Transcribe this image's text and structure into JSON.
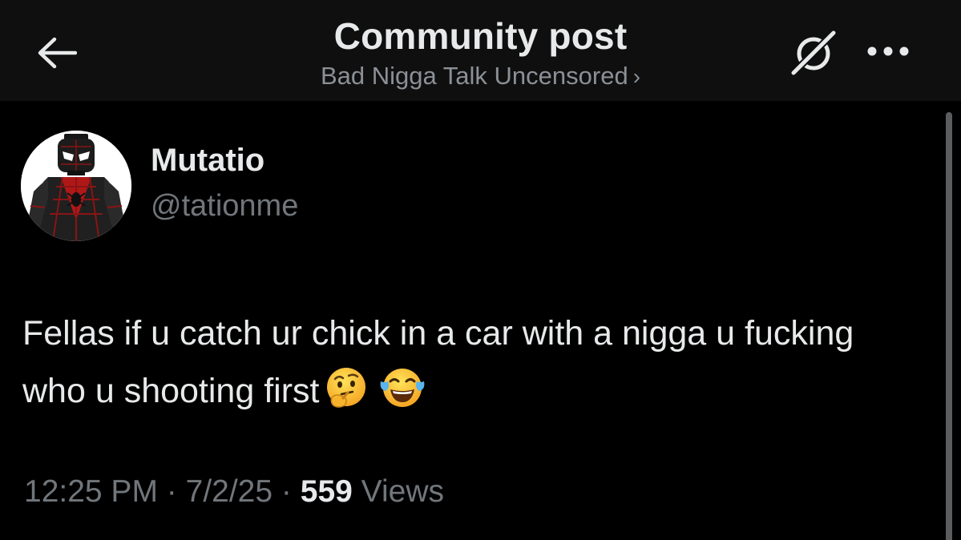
{
  "header": {
    "title": "Community post",
    "subtitle": "Bad Nigga Talk Uncensored",
    "subtitle_chevron": "›",
    "icons": {
      "back": "arrow-left-icon",
      "grok": "grok-icon",
      "more": "more-horizontal-icon"
    }
  },
  "post": {
    "author": {
      "display_name": "Mutatio",
      "handle": "@tationme",
      "avatar": "spiderman-lego-avatar"
    },
    "text": "Fellas if u catch ur chick in a car with a nigga u fucking who u shooting first",
    "emojis": [
      "thinking-face-emoji",
      "tears-of-joy-emoji"
    ],
    "time": "12:25 PM",
    "separator": "·",
    "date": "7/2/25",
    "views_count": "559",
    "views_label": "Views"
  },
  "colors": {
    "background": "#000000",
    "header_background": "#0f0f0f",
    "primary_text": "#e7e9ea",
    "secondary_text": "#71767b"
  }
}
